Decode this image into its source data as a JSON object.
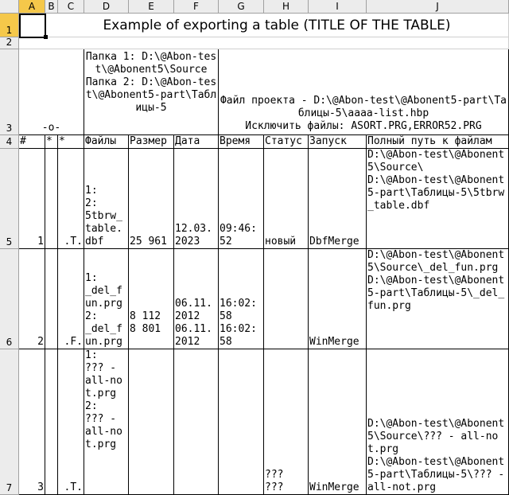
{
  "columns": [
    "A",
    "B",
    "C",
    "D",
    "E",
    "F",
    "G",
    "H",
    "I",
    "J"
  ],
  "rows": [
    "1",
    "2",
    "3",
    "4",
    "5",
    "6",
    "7"
  ],
  "title": "Example of exporting a table (TITLE OF THE TABLE)",
  "header3": {
    "mark": "-o-",
    "folders": "Папка 1: D:\\@Abon-test\\@Abonent5\\Source\nПапка 2: D:\\@Abon-test\\@Abonent5-part\\Таблицы-5",
    "project": "Файл проекта - D:\\@Abon-test\\@Abonent5-part\\Таблицы-5\\aaaa-list.hbp\nИсключить файлы: ASORT.PRG,ERROR52.PRG"
  },
  "header4": [
    "#",
    "*",
    "*",
    "Файлы",
    "Размер",
    "Дата",
    "Время",
    "Статус",
    "Запуск",
    "Полный путь к файлам"
  ],
  "data_rows": [
    {
      "num": "1",
      "b": "",
      "c": ".T.",
      "files": "1:\n2:\n5tbrw_table.dbf",
      "size": "25 961",
      "date": "12.03.2023",
      "time": "09:46:52",
      "status": "новый",
      "launch": "DbfMerge",
      "path": "D:\\@Abon-test\\@Abonent5\\Source\\\nD:\\@Abon-test\\@Abonent5-part\\Таблицы-5\\5tbrw_table.dbf"
    },
    {
      "num": "2",
      "b": "",
      "c": ".F.",
      "files": "1:\n_del_fun.prg\n2:\n_del_fun.prg",
      "size": "8 112\n8 801",
      "date": "06.11.2012\n06.11.2012",
      "time": "16:02:58\n16:02:58",
      "status": "",
      "launch": "WinMerge",
      "path": "D:\\@Abon-test\\@Abonent5\\Source\\_del_fun.prg\nD:\\@Abon-test\\@Abonent5-part\\Таблицы-5\\_del_fun.prg"
    },
    {
      "num": "3",
      "b": "",
      "c": ".T.",
      "files": "1:\n??? - all-not.prg\n2:\n??? - all-not.prg",
      "size": "",
      "date": "",
      "time": "",
      "status": "???\n???",
      "launch": "WinMerge",
      "path": "D:\\@Abon-test\\@Abonent5\\Source\\??? - all-not.prg\nD:\\@Abon-test\\@Abonent5-part\\Таблицы-5\\??? - all-not.prg"
    }
  ]
}
